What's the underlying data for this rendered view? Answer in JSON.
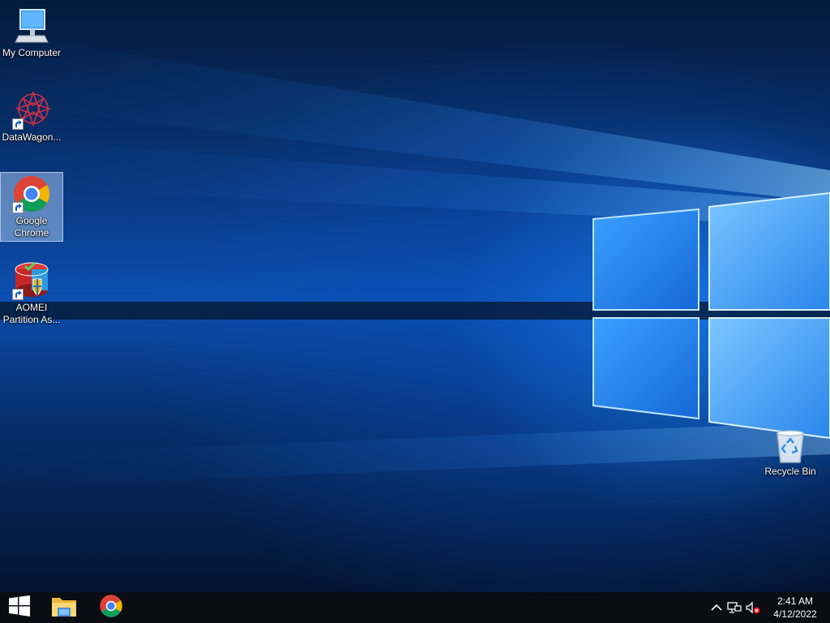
{
  "desktop": {
    "icons": [
      {
        "label": "My Computer",
        "icon": "computer-icon"
      },
      {
        "label": "DataWagon...",
        "icon": "datawagon-icon"
      },
      {
        "label": "Google Chrome",
        "icon": "chrome-icon"
      },
      {
        "label": "AOMEI Partition As...",
        "icon": "aomei-icon"
      },
      {
        "label": "Recycle Bin",
        "icon": "recycle-bin-icon"
      }
    ],
    "selected_icon": "Google Chrome"
  },
  "taskbar": {
    "pinned": [
      {
        "name": "File Explorer",
        "icon": "folder-icon"
      },
      {
        "name": "Google Chrome",
        "icon": "chrome-icon"
      }
    ],
    "tray": {
      "icons": [
        "chevron-up-icon",
        "network-icon",
        "volume-muted-icon"
      ]
    },
    "clock": {
      "time": "2:41 AM",
      "date": "4/12/2022"
    }
  },
  "colors": {
    "taskbar": "#0a0d14",
    "wallpaper_accent": "#1e8cff",
    "selection": "#a0c3eb"
  }
}
